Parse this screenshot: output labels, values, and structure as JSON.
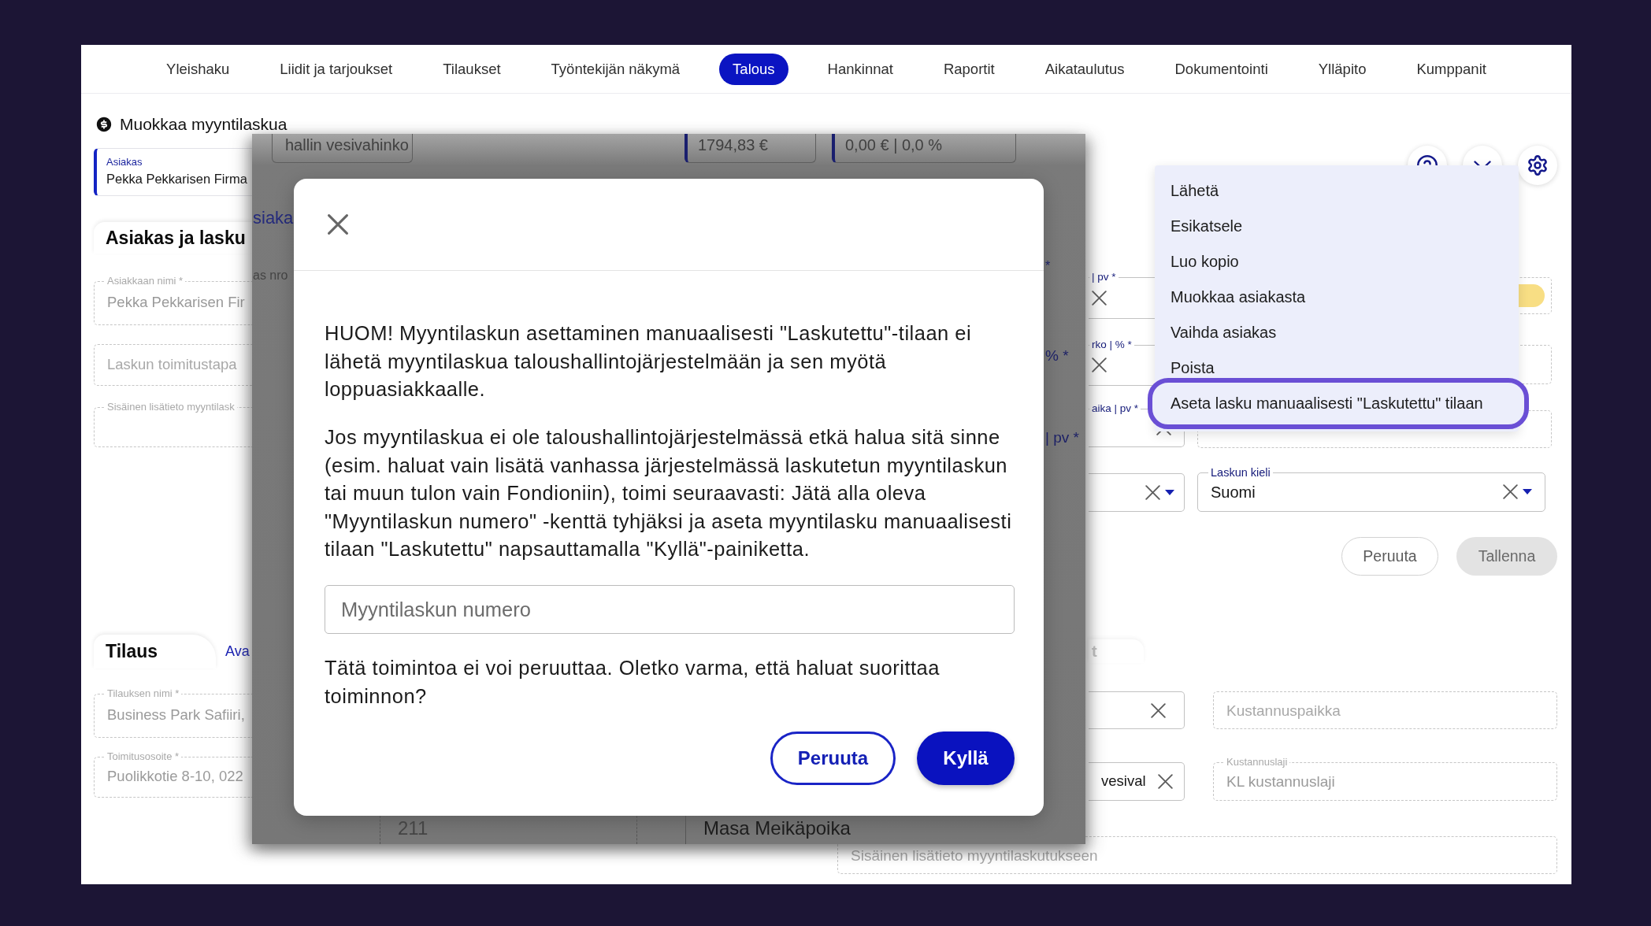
{
  "nav": {
    "items": [
      {
        "label": "Yleishaku",
        "selected": false
      },
      {
        "label": "Liidit ja tarjoukset",
        "selected": false
      },
      {
        "label": "Tilaukset",
        "selected": false
      },
      {
        "label": "Työntekijän näkymä",
        "selected": false
      },
      {
        "label": "Talous",
        "selected": true
      },
      {
        "label": "Hankinnat",
        "selected": false
      },
      {
        "label": "Raportit",
        "selected": false
      },
      {
        "label": "Aikataulutus",
        "selected": false
      },
      {
        "label": "Dokumentointi",
        "selected": false
      },
      {
        "label": "Ylläpito",
        "selected": false
      },
      {
        "label": "Kumppanit",
        "selected": false
      }
    ]
  },
  "page": {
    "title": "Muokkaa myyntilaskua"
  },
  "customer_card": {
    "label": "Asiakas",
    "value": "Pekka Pekkarisen Firma"
  },
  "customer_section": {
    "tab": "Asiakas ja lasku",
    "fields": [
      {
        "label": "Asiakkaan nimi *",
        "value": "Pekka Pekkarisen Fir",
        "disabled": true
      },
      {
        "placeholder": "Laskun toimitustapa",
        "disabled": true
      },
      {
        "label": "Sisäinen lisätieto myyntilask",
        "disabled": true
      }
    ]
  },
  "order_section": {
    "tab": "Tilaus",
    "link": "Ava",
    "fields": [
      {
        "label": "Tilauksen nimi *",
        "value": "Business Park Safiiri,",
        "disabled": true
      },
      {
        "label": "Toimitusosoite *",
        "value": "Puolikkotie 8-10, 022",
        "disabled": true
      }
    ]
  },
  "background": {
    "top_fields": [
      {
        "value": "hallin vesivahinko",
        "accent": false
      },
      {
        "value": "1794,83 €",
        "accent": true
      },
      {
        "value": "0,00 € | 0,0 %",
        "accent": true
      }
    ],
    "left_texts": [
      {
        "kind": "heading",
        "text": "siaka"
      },
      {
        "kind": "label",
        "text": "as nro"
      }
    ],
    "right_labels": [
      "*",
      "% *",
      "| pv *"
    ],
    "bottom_fields": [
      {
        "value": "211",
        "disabled": true
      },
      {
        "value": "Masa Meikäpoika",
        "disabled": false
      }
    ]
  },
  "dialog": {
    "paragraphs": [
      "HUOM! Myyntilaskun asettaminen manuaalisesti \"Laskutettu\"-tilaan ei\nlähetä myyntilaskua taloushallintojärjestelmään ja sen myötä\nloppuasiakkaalle.",
      "Jos myyntilaskua ei ole taloushallintojärjestelmässä etkä halua sitä sinne\n(esim. haluat vain lisätä vanhassa järjestelmässä laskutetun myyntilaskun\ntai muun tulon vain Fondioniin), toimi seuraavasti: Jätä alla oleva\n\"Myyntilaskun numero\" -kenttä tyhjäksi ja aseta myyntilasku manuaalisesti\ntilaan \"Laskutettu\" napsauttamalla \"Kyllä\"-painiketta."
    ],
    "input": {
      "placeholder": "Myyntilaskun numero"
    },
    "question": "Tätä toimintoa ei voi peruuttaa. Oletko varma, että haluat suorittaa\ntoiminnon?",
    "buttons": [
      {
        "label": "Peruuta",
        "kind": "secondary"
      },
      {
        "label": "Kyllä",
        "kind": "primary"
      }
    ]
  },
  "side_fields": [
    {
      "kind": "text",
      "label": "| pv *",
      "disabled": false
    },
    {
      "kind": "text",
      "label": "rko | % *",
      "disabled": false
    },
    {
      "kind": "text",
      "label": "aika | pv *",
      "disabled": false
    },
    {
      "kind": "select",
      "disabled": false
    },
    {
      "kind": "text",
      "disabled": false
    },
    {
      "kind": "text",
      "value": "vesival",
      "disabled": false
    }
  ],
  "side_tab": {
    "label": "t"
  },
  "right_fields": [
    {
      "kind": "toggle",
      "disabled": true
    },
    {
      "kind": "text",
      "disabled": true
    },
    {
      "kind": "text",
      "disabled": true
    },
    {
      "kind": "select",
      "label": "Laskun kieli",
      "value": "Suomi",
      "disabled": false
    }
  ],
  "form_buttons": [
    {
      "label": "Peruuta",
      "disabled": false
    },
    {
      "label": "Tallenna",
      "disabled": true
    }
  ],
  "cost_fields": [
    {
      "placeholder": "Kustannuspaikka",
      "disabled": true
    },
    {
      "label": "Kustannuslaji",
      "value": "KL kustannuslaji",
      "disabled": true
    }
  ],
  "note_field": {
    "placeholder": "Sisäinen lisätieto myyntilaskutukseen",
    "disabled": true
  },
  "actions_menu": {
    "items": [
      {
        "label": "Lähetä",
        "highlighted": false
      },
      {
        "label": "Esikatsele",
        "highlighted": false
      },
      {
        "label": "Luo kopio",
        "highlighted": false
      },
      {
        "label": "Muokkaa asiakasta",
        "highlighted": false
      },
      {
        "label": "Vaihda asiakas",
        "highlighted": false
      },
      {
        "label": "Poista",
        "highlighted": false
      },
      {
        "label": "Aseta lasku manuaalisesti \"Laskutettu\" tilaan",
        "highlighted": true
      }
    ]
  }
}
